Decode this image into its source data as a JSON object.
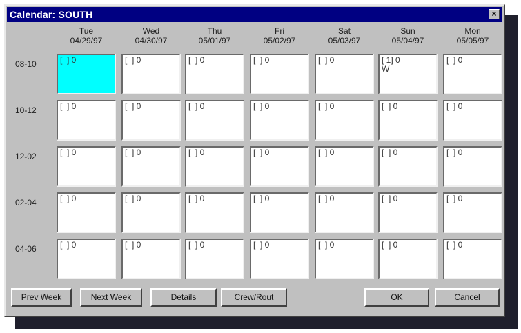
{
  "window": {
    "title": "Calendar: SOUTH",
    "close_label": "×"
  },
  "days": [
    {
      "name": "Tue",
      "date": "04/29/97"
    },
    {
      "name": "Wed",
      "date": "04/30/97"
    },
    {
      "name": "Thu",
      "date": "05/01/97"
    },
    {
      "name": "Fri",
      "date": "05/02/97"
    },
    {
      "name": "Sat",
      "date": "05/03/97"
    },
    {
      "name": "Sun",
      "date": "05/04/97"
    },
    {
      "name": "Mon",
      "date": "05/05/97"
    }
  ],
  "time_slots": [
    "08-10",
    "10-12",
    "12-02",
    "02-04",
    "04-06"
  ],
  "cells": [
    [
      "[  ] 0",
      "[  ] 0",
      "[  ] 0",
      "[  ] 0",
      "[  ] 0",
      "[ 1] 0\nW",
      "[  ] 0"
    ],
    [
      "[  ] 0",
      "[  ] 0",
      "[  ] 0",
      "[  ] 0",
      "[  ] 0",
      "[  ] 0",
      "[  ] 0"
    ],
    [
      "[  ] 0",
      "[  ] 0",
      "[  ] 0",
      "[  ] 0",
      "[  ] 0",
      "[  ] 0",
      "[  ] 0"
    ],
    [
      "[  ] 0",
      "[  ] 0",
      "[  ] 0",
      "[  ] 0",
      "[  ] 0",
      "[  ] 0",
      "[  ] 0"
    ],
    [
      "[  ] 0",
      "[  ] 0",
      "[  ] 0",
      "[  ] 0",
      "[  ] 0",
      "[  ] 0",
      "[  ] 0"
    ]
  ],
  "selected_cell": {
    "row": 0,
    "col": 0,
    "color": "#00ffff"
  },
  "buttons": {
    "prev_week": {
      "accel": "P",
      "rest": "rev Week"
    },
    "next_week": {
      "accel": "N",
      "rest": "ext Week"
    },
    "details": {
      "accel": "D",
      "rest": "etails"
    },
    "crew_rout": {
      "pre": "Crew/",
      "accel": "R",
      "rest": "out"
    },
    "ok": {
      "accel": "O",
      "rest": "K"
    },
    "cancel": {
      "accel": "C",
      "rest": "ancel"
    }
  },
  "colors": {
    "title_bar": "#000082",
    "window_bg": "#c0c0c0"
  }
}
